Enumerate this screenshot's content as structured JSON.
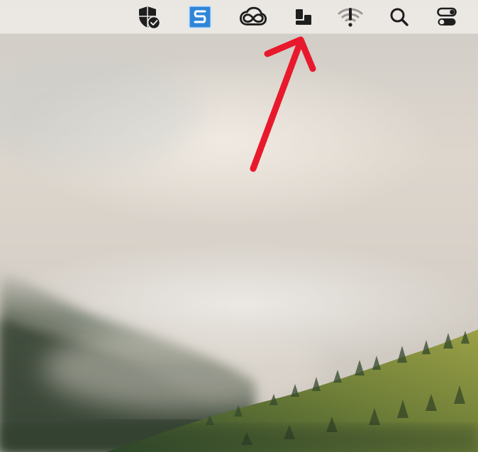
{
  "colors": {
    "menubar_icon": "#1e1e1e",
    "menubar_icon_dim": "#9a9794",
    "snagit_blue": "#2f86d8",
    "annotation_arrow": "#e8192c",
    "forest_dark": "#2f3d2c",
    "forest_lit": "#7f8f3a"
  },
  "menubar": {
    "items": [
      {
        "name": "security-shield-icon"
      },
      {
        "name": "snagit-icon"
      },
      {
        "name": "creative-cloud-icon"
      },
      {
        "name": "stage-manager-icon",
        "highlighted": true
      },
      {
        "name": "wifi-alert-icon"
      },
      {
        "name": "search-icon"
      },
      {
        "name": "control-center-icon"
      }
    ]
  },
  "annotation": {
    "type": "arrow",
    "points_to": "stage-manager-icon"
  }
}
